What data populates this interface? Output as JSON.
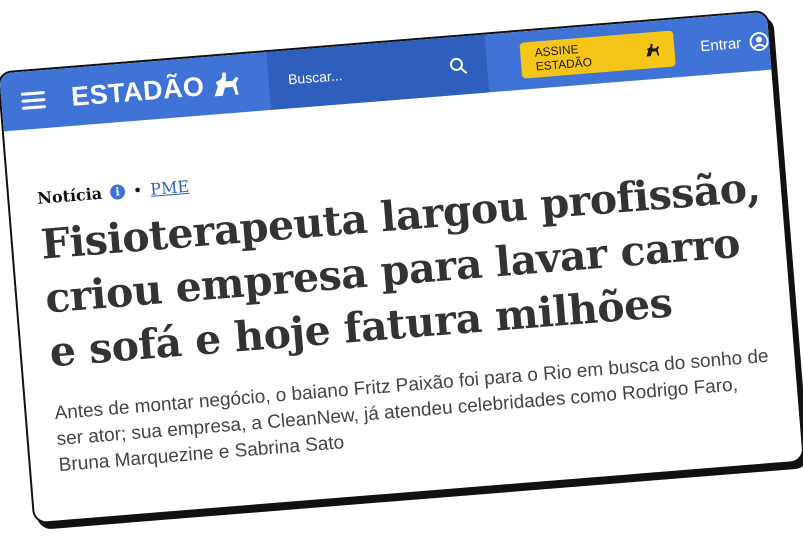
{
  "header": {
    "logo_text": "ESTADÃO",
    "search_placeholder": "Buscar...",
    "subscribe_label": "ASSINE ESTADÃO",
    "login_label": "Entrar",
    "brand_color": "#3f74d6",
    "accent_color": "#f5c518"
  },
  "article": {
    "type_label": "Notícia",
    "section": "PME",
    "headline": "Fisioterapeuta largou profissão, criou empresa para lavar carro e sofá e hoje fatura  milhões",
    "summary": "Antes de montar negócio, o baiano Fritz Paixão foi para o Rio em busca do sonho de ser ator; sua empresa, a CleanNew, já atendeu celebridades como Rodrigo Faro, Bruna Marquezine e Sabrina Sato"
  },
  "icons": {
    "menu": "hamburger-menu-icon",
    "logo_horse": "horse-rider-icon",
    "search": "magnifier-icon",
    "user": "user-circle-icon",
    "info": "info-icon"
  }
}
